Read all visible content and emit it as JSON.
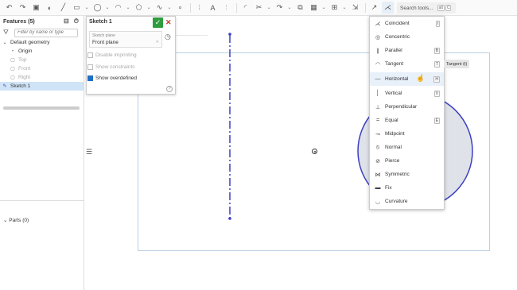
{
  "toolbar": {
    "search_placeholder": "Search tools...",
    "search_key_1": "alt",
    "search_key_2": "C",
    "items": [
      {
        "name": "undo-icon",
        "glyph": "↶"
      },
      {
        "name": "redo-icon",
        "glyph": "↷"
      },
      {
        "name": "sketch-icon",
        "glyph": "▣"
      },
      {
        "name": "show-constraints-icon",
        "glyph": "◐"
      },
      {
        "name": "line-icon",
        "glyph": "╱"
      },
      {
        "name": "rectangle-icon",
        "glyph": "▭"
      },
      {
        "name": "circle-icon",
        "glyph": "◯"
      },
      {
        "name": "arc-icon",
        "glyph": "◠"
      },
      {
        "name": "polygon-icon",
        "glyph": "⬠"
      },
      {
        "name": "spline-icon",
        "glyph": "∿"
      },
      {
        "name": "point-icon",
        "glyph": "∘"
      },
      {
        "name": "construction-icon",
        "glyph": "⦙"
      },
      {
        "name": "text-icon",
        "glyph": "A"
      },
      {
        "name": "mirror-icon",
        "glyph": "⫶"
      },
      {
        "name": "fillet-icon",
        "glyph": "◜"
      },
      {
        "name": "trim-icon",
        "glyph": "✂"
      },
      {
        "name": "offset-icon",
        "glyph": "↷"
      },
      {
        "name": "use-icon",
        "glyph": "⧉"
      },
      {
        "name": "pattern-icon",
        "glyph": "▦"
      },
      {
        "name": "transform-icon",
        "glyph": "⊞"
      },
      {
        "name": "import-icon",
        "glyph": "⇲"
      },
      {
        "name": "dimension-icon",
        "glyph": "↗"
      },
      {
        "name": "constraint-icon",
        "glyph": "⋌"
      }
    ]
  },
  "features": {
    "title": "Features (5)",
    "filter_placeholder": "Filter by name or type",
    "items": [
      {
        "label": "Default geometry",
        "icon": "⌄",
        "style": "caret"
      },
      {
        "label": "Origin",
        "icon": "•",
        "style": "child"
      },
      {
        "label": "Top",
        "icon": "▢",
        "style": "dim"
      },
      {
        "label": "Front",
        "icon": "▢",
        "style": "dim"
      },
      {
        "label": "Right",
        "icon": "▢",
        "style": "dim"
      },
      {
        "label": "Sketch 1",
        "icon": "✎",
        "style": "sel"
      }
    ],
    "parts_label": "Parts (0)"
  },
  "sketch_dialog": {
    "title": "Sketch 1",
    "plane_label": "Sketch plane",
    "plane_value": "Front plane",
    "disable_imprinting": "Disable imprinting",
    "show_constraints": "Show constraints",
    "show_overdefined": "Show overdefined",
    "help": "?"
  },
  "constraints_menu": {
    "items": [
      {
        "label": "Coincident",
        "icon": "⋌",
        "key": "I"
      },
      {
        "label": "Concentric",
        "icon": "◎",
        "key": ""
      },
      {
        "label": "Parallel",
        "icon": "∥",
        "key": "B"
      },
      {
        "label": "Tangent",
        "icon": "◠",
        "key": "T"
      },
      {
        "label": "Horizontal",
        "icon": "—",
        "key": "H"
      },
      {
        "label": "Vertical",
        "icon": "│",
        "key": "V"
      },
      {
        "label": "Perpendicular",
        "icon": "⊥",
        "key": ""
      },
      {
        "label": "Equal",
        "icon": "=",
        "key": "E"
      },
      {
        "label": "Midpoint",
        "icon": "⊸",
        "key": ""
      },
      {
        "label": "Normal",
        "icon": "⦸",
        "key": ""
      },
      {
        "label": "Pierce",
        "icon": "⊘",
        "key": ""
      },
      {
        "label": "Symmetric",
        "icon": "⋈",
        "key": ""
      },
      {
        "label": "Fix",
        "icon": "▬",
        "key": ""
      },
      {
        "label": "Curvature",
        "icon": "◡",
        "key": ""
      }
    ],
    "tooltip": "Tangent (t)"
  },
  "colors": {
    "sketch_blue": "#3b3fc4",
    "circle_fill": "#dfe2e8",
    "accent_green": "#2e9c3f"
  }
}
